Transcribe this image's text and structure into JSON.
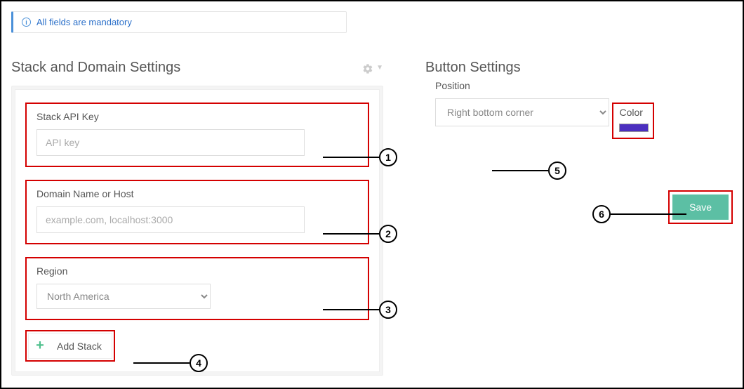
{
  "alert": {
    "text": "All fields are mandatory"
  },
  "left": {
    "title": "Stack and Domain Settings",
    "apiKey": {
      "label": "Stack API Key",
      "placeholder": "API key"
    },
    "domain": {
      "label": "Domain Name or Host",
      "placeholder": "example.com, localhost:3000"
    },
    "region": {
      "label": "Region",
      "value": "North America"
    },
    "addStack": {
      "label": "Add Stack"
    }
  },
  "right": {
    "title": "Button Settings",
    "position": {
      "label": "Position",
      "value": "Right bottom corner"
    },
    "color": {
      "label": "Color",
      "hex": "#4b2fbf"
    },
    "save": {
      "label": "Save"
    }
  },
  "annotations": {
    "n1": "1",
    "n2": "2",
    "n3": "3",
    "n4": "4",
    "n5": "5",
    "n6": "6"
  }
}
